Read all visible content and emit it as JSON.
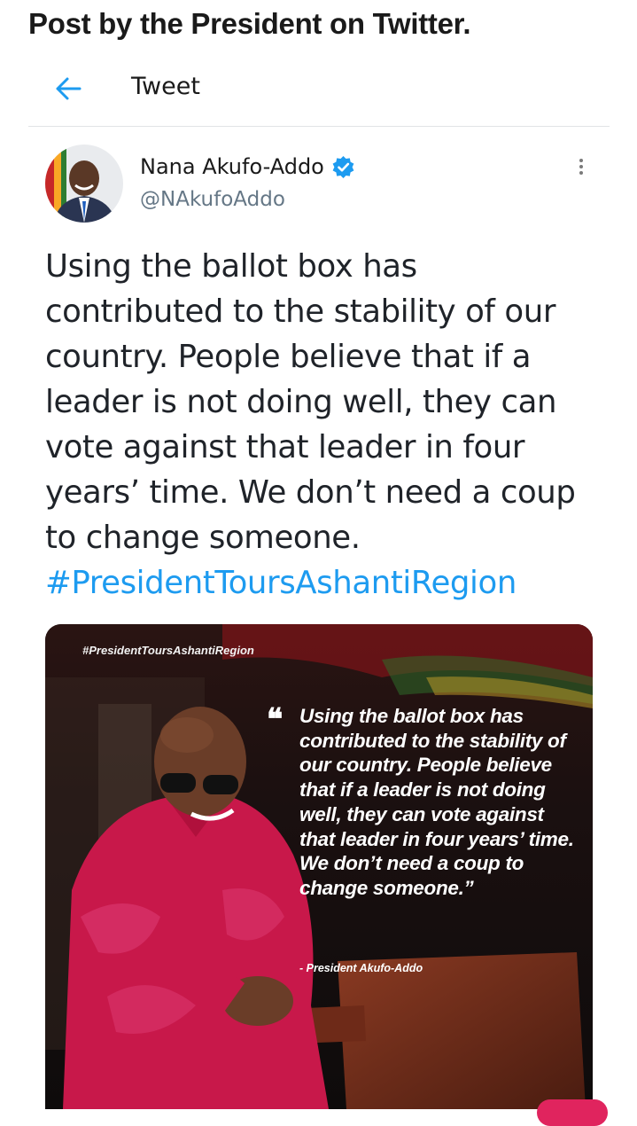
{
  "caption": "Post by the President on Twitter.",
  "header": {
    "back_icon": "arrow-left-icon",
    "title": "Tweet"
  },
  "author": {
    "name": "Nana Akufo-Addo",
    "handle": "@NAkufoAddo",
    "verified_icon": "verified-badge-icon"
  },
  "tweet": {
    "text": "Using the ballot box has contributed to the stability of our country. People believe that if a leader is not doing well, they can vote against that leader in four years’ time. We don’t need a coup to change someone.",
    "hashtag": "#PresidentToursAshantiRegion"
  },
  "media": {
    "tag": "#PresidentToursAshantiRegion",
    "quote_mark": "❝",
    "quote": "Using the ballot box has contributed to the stability of our country. People believe that if a leader is not doing well, they can vote against that leader in four years’ time. We don’t need a coup to change someone.”",
    "attribution": "- President Akufo-Addo"
  },
  "colors": {
    "accent": "#1d9bf0",
    "handle": "#657786",
    "shirt": "#c8184a"
  }
}
